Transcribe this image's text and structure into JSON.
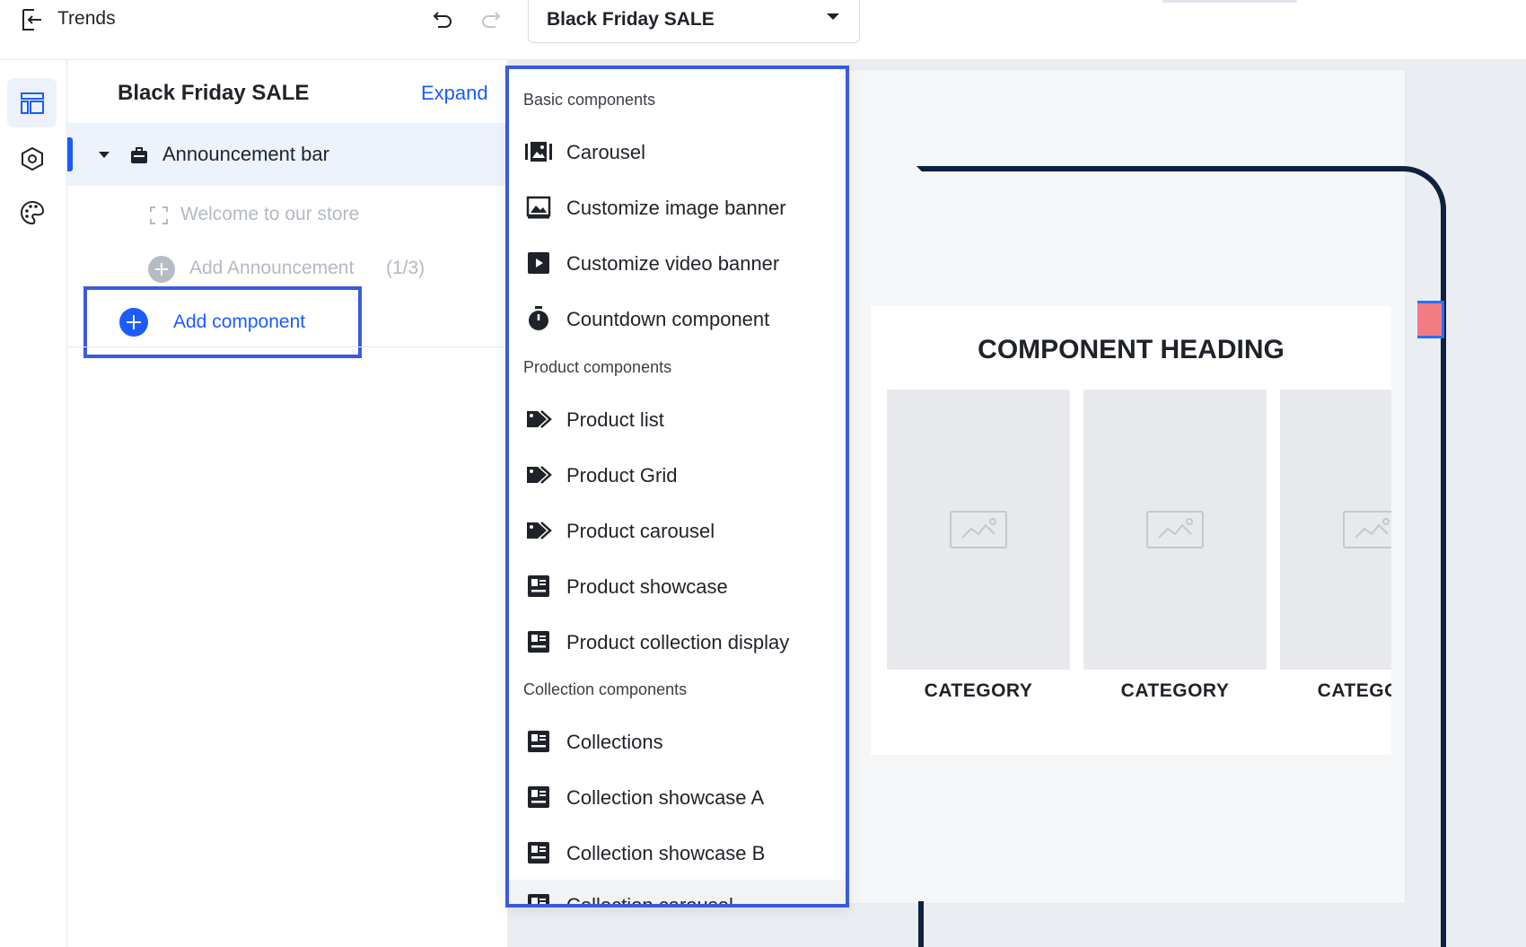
{
  "topbar": {
    "exit_icon": "exit-icon",
    "title": "Trends",
    "undo_icon": "undo-icon",
    "redo_icon": "redo-icon",
    "page_select": {
      "value": "Black Friday SALE"
    }
  },
  "rail": {
    "items": [
      {
        "name": "layout-icon",
        "active": true
      },
      {
        "name": "settings-hexagon-icon",
        "active": false
      },
      {
        "name": "palette-icon",
        "active": false
      }
    ]
  },
  "panel": {
    "title": "Black Friday SALE",
    "expand_label": "Expand",
    "section": {
      "label": "Announcement bar",
      "icon": "briefcase-icon"
    },
    "children": [
      {
        "label": "Welcome to our store",
        "icon": "frame-icon"
      }
    ],
    "add_announcement": {
      "label": "Add Announcement",
      "count": "(1/3)"
    },
    "add_component": {
      "label": "Add component"
    }
  },
  "menu": {
    "groups": [
      {
        "label": "Basic components",
        "items": [
          {
            "label": "Carousel",
            "icon": "carousel-icon"
          },
          {
            "label": "Customize image banner",
            "icon": "image-icon"
          },
          {
            "label": "Customize video banner",
            "icon": "video-icon"
          },
          {
            "label": "Countdown component",
            "icon": "stopwatch-icon"
          }
        ]
      },
      {
        "label": "Product components",
        "items": [
          {
            "label": "Product list",
            "icon": "tags-icon"
          },
          {
            "label": "Product Grid",
            "icon": "tags-icon"
          },
          {
            "label": "Product carousel",
            "icon": "tags-icon"
          },
          {
            "label": "Product showcase",
            "icon": "showcase-icon"
          },
          {
            "label": "Product collection display",
            "icon": "showcase-icon"
          }
        ]
      },
      {
        "label": "Collection components",
        "items": [
          {
            "label": "Collections",
            "icon": "showcase-icon"
          },
          {
            "label": "Collection showcase A",
            "icon": "showcase-icon"
          },
          {
            "label": "Collection showcase B",
            "icon": "showcase-icon"
          },
          {
            "label": "Collection carousel",
            "icon": "showcase-icon"
          }
        ]
      }
    ]
  },
  "preview": {
    "heading": "COMPONENT HEADING",
    "categories": [
      "CATEGORY",
      "CATEGORY",
      "CATEGORY"
    ]
  },
  "colors": {
    "accent": "#1a5cff",
    "highlight_border": "#3b5bdb",
    "phone_frame": "#0f2140",
    "tag_red": "#f07c84"
  }
}
